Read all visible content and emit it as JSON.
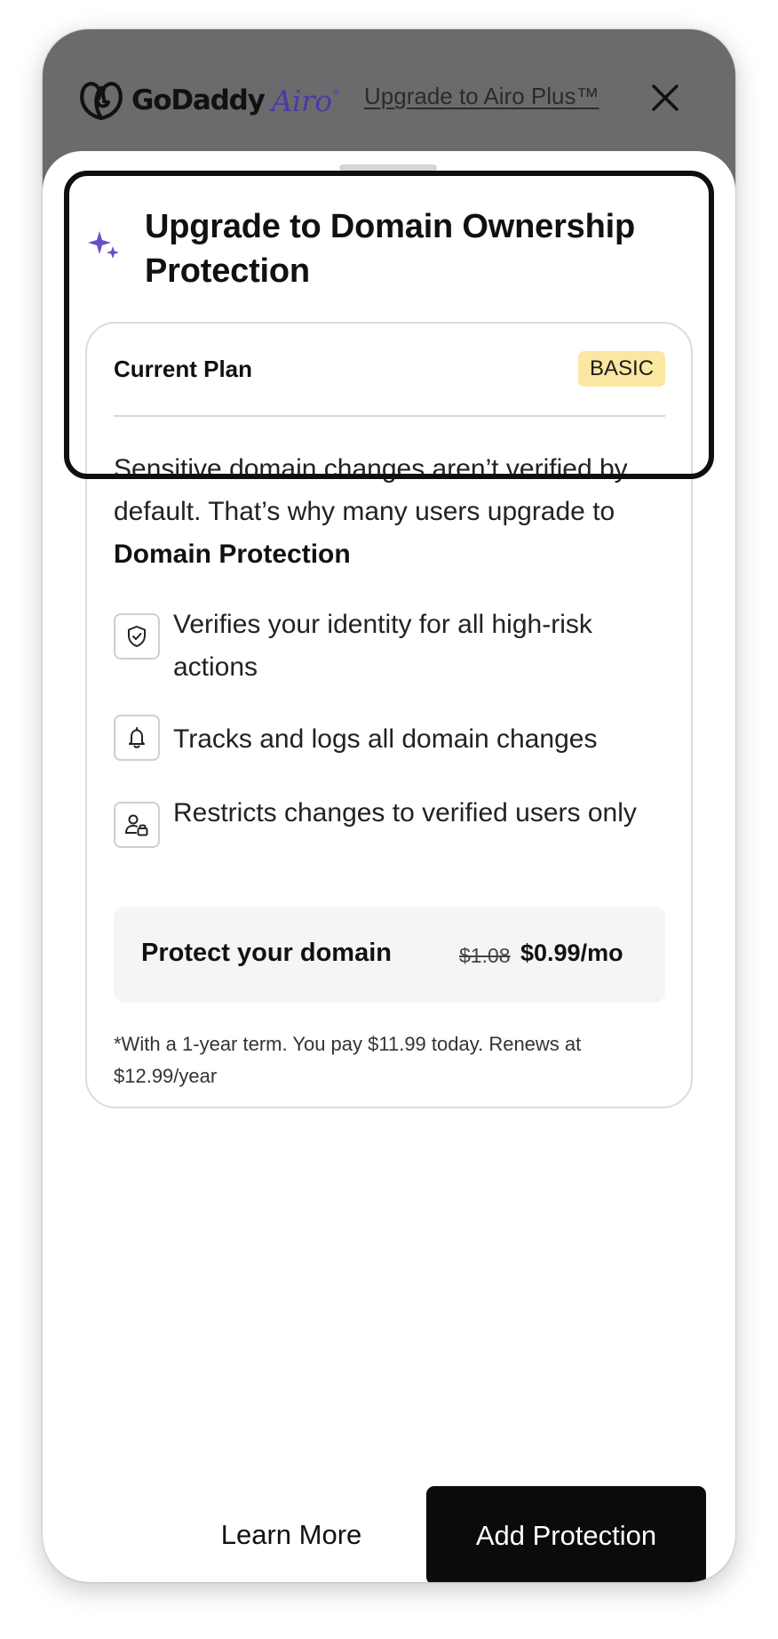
{
  "header": {
    "logo_text": "GoDaddy",
    "logo_sub": "Airo",
    "logo_reg": "®",
    "upgrade_link": "Upgrade to Airo Plus™",
    "close_icon": "close-icon"
  },
  "sheet": {
    "title": "Upgrade to Domain Ownership Protection",
    "title_icon": "sparkle-icon"
  },
  "current_plan": {
    "label": "Current Plan",
    "badge": "BASIC",
    "description_prefix": "Sensitive domain changes aren’t verified by default. That’s why many users upgrade to ",
    "description_bold": "Domain Protection"
  },
  "features": [
    {
      "icon": "shield-check-icon",
      "text": "Verifies your identity for all high-risk actions"
    },
    {
      "icon": "bell-icon",
      "text": "Tracks and logs all domain changes"
    },
    {
      "icon": "user-lock-icon",
      "text": "Restricts changes to verified users only"
    }
  ],
  "pricing": {
    "label": "Protect your domain",
    "old_price": "$1.08",
    "new_price": "$0.99/mo",
    "fine_print": "*With a 1-year term. You pay $11.99 today. Renews at $12.99/year"
  },
  "actions": {
    "learn_more": "Learn More",
    "add_protection": "Add Protection"
  },
  "colors": {
    "accent_purple": "#4b3aa3",
    "badge_yellow": "#fbe7a2",
    "primary_button": "#0b0b0b",
    "header_gray": "#6b6b6d"
  }
}
